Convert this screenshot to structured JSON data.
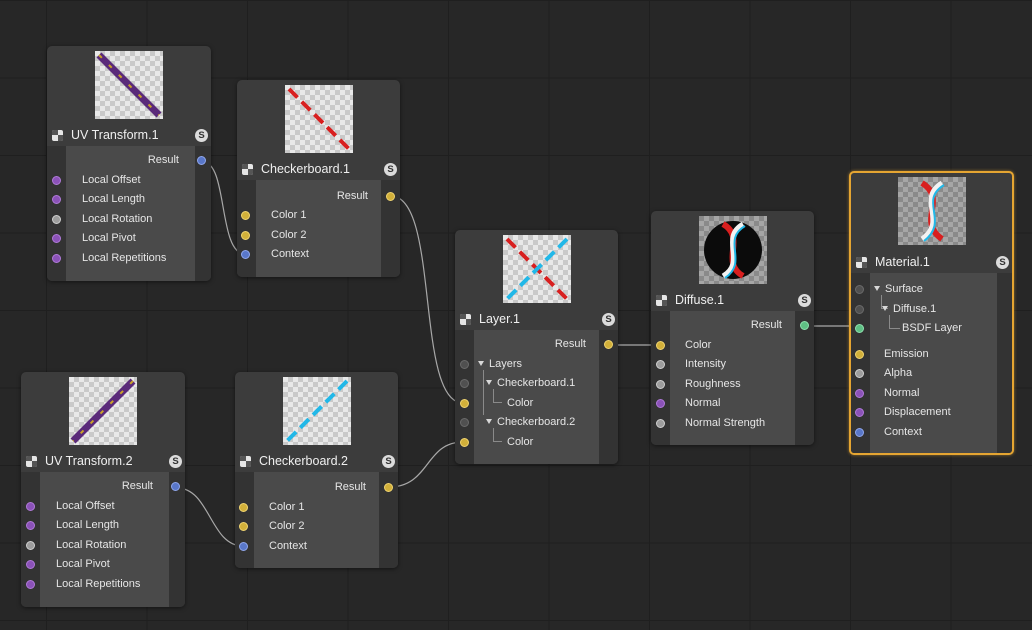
{
  "nodes": {
    "uv1": {
      "title": "UV Transform.1",
      "solo": "S",
      "result": "Result",
      "inputs": [
        "Local Offset",
        "Local Length",
        "Local Rotation",
        "Local Pivot",
        "Local Repetitions"
      ]
    },
    "cb1": {
      "title": "Checkerboard.1",
      "solo": "S",
      "result": "Result",
      "inputs": [
        "Color 1",
        "Color 2",
        "Context"
      ]
    },
    "uv2": {
      "title": "UV Transform.2",
      "solo": "S",
      "result": "Result",
      "inputs": [
        "Local Offset",
        "Local Length",
        "Local Rotation",
        "Local Pivot",
        "Local Repetitions"
      ]
    },
    "cb2": {
      "title": "Checkerboard.2",
      "solo": "S",
      "result": "Result",
      "inputs": [
        "Color 1",
        "Color 2",
        "Context"
      ]
    },
    "layer": {
      "title": "Layer.1",
      "solo": "S",
      "result": "Result",
      "layers": "Layers",
      "cb1": "Checkerboard.1",
      "color1": "Color",
      "cb2": "Checkerboard.2",
      "color2": "Color"
    },
    "diffuse": {
      "title": "Diffuse.1",
      "solo": "S",
      "result": "Result",
      "inputs": [
        "Color",
        "Intensity",
        "Roughness",
        "Normal",
        "Normal Strength"
      ]
    },
    "material": {
      "title": "Material.1",
      "solo": "S",
      "surface": "Surface",
      "diffuse": "Diffuse.1",
      "bsdf": "BSDF Layer",
      "inputs": [
        "Emission",
        "Alpha",
        "Normal",
        "Displacement",
        "Context"
      ]
    }
  },
  "colors": {
    "canvas": "#272727",
    "node_bg": "#3c3c3c",
    "selected_outline": "#e5a532",
    "port_purple": "#8b52b8",
    "port_gray": "#9d9d9d",
    "port_blue": "#5977c9",
    "port_yellow": "#d2b03a",
    "port_green": "#5fbf84",
    "checker_red": "#d81f1f",
    "checker_cyan": "#21b8e8"
  },
  "icons": {
    "node": "checker-node-icon",
    "solo": "solo-s-icon",
    "expand": "triangle-down-icon"
  }
}
